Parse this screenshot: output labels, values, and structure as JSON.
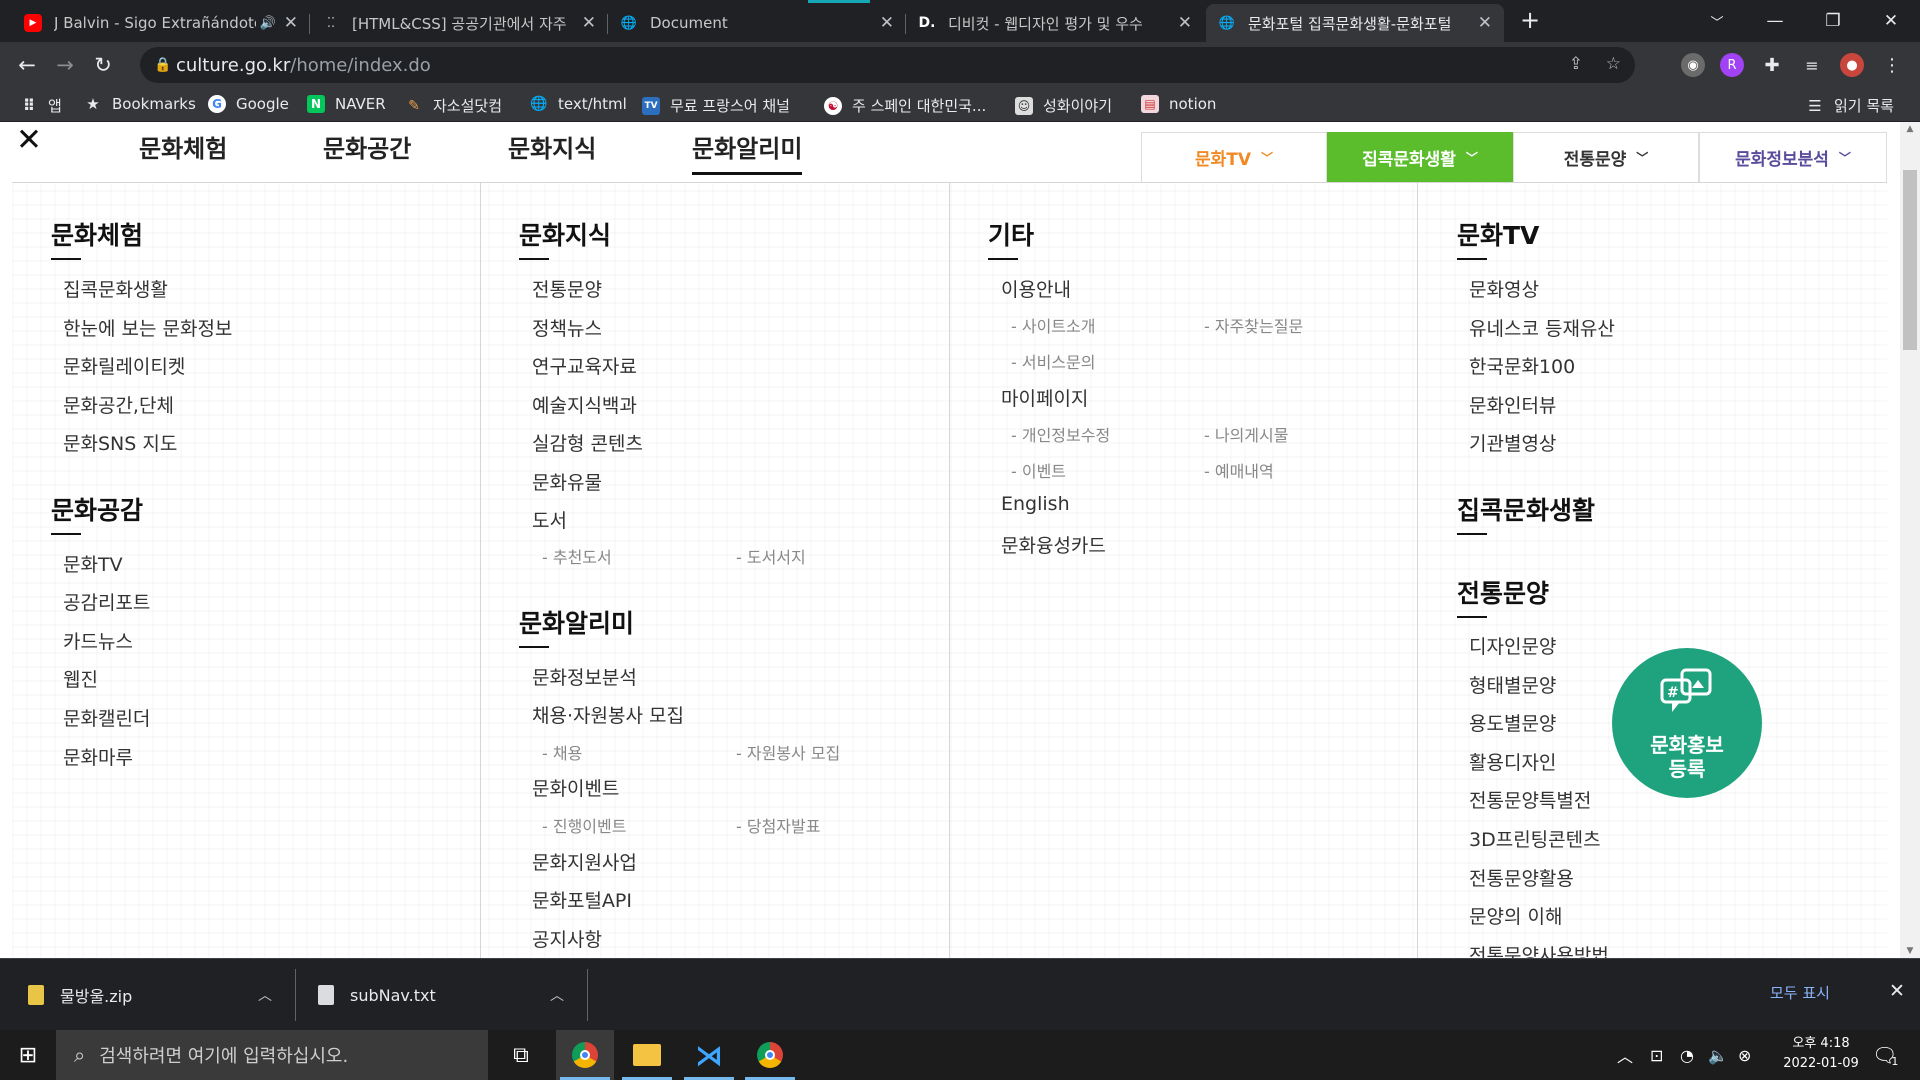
{
  "browser": {
    "tabs": [
      {
        "title": "J Balvin - Sigo Extrañándote",
        "icon": "youtube-icon"
      },
      {
        "title": "[HTML&CSS] 공공기관에서 자주",
        "icon": "tistory-icon"
      },
      {
        "title": "Document",
        "icon": "globe-icon"
      },
      {
        "title": "디비컷 - 웹디자인 평가 및 우수",
        "icon": "dbcut-icon"
      },
      {
        "title": "문화포털 집콕문화생활-문화포털",
        "icon": "globe-icon"
      }
    ],
    "url_host": "culture.go.kr",
    "url_path": "/home/index.do",
    "bookmarks": [
      "앱",
      "Bookmarks",
      "Google",
      "NAVER",
      "자소설닷컴",
      "text/html",
      "무료 프랑스어 채널",
      "주 스페인 대한민국...",
      "성화이야기",
      "notion"
    ],
    "reading_list": "읽기 목록"
  },
  "page": {
    "gnb": [
      "문화체험",
      "문화공간",
      "문화지식",
      "문화알리미"
    ],
    "quick_menu": [
      {
        "label": "문화TV",
        "color": "#f08a24"
      },
      {
        "label": "집콕문화생활",
        "color": "#ffffff",
        "bg": "#5bbd2b"
      },
      {
        "label": "전통문양",
        "color": "#333333"
      },
      {
        "label": "문화정보분석",
        "color": "#5a4b9c"
      }
    ],
    "columns": {
      "col1": {
        "sec1": {
          "title": "문화체험",
          "items": [
            "집콕문화생활",
            "한눈에 보는 문화정보",
            "문화릴레이티켓",
            "문화공간,단체",
            "문화SNS 지도"
          ]
        },
        "sec2": {
          "title": "문화공감",
          "items": [
            "문화TV",
            "공감리포트",
            "카드뉴스",
            "웹진",
            "문화캘린더",
            "문화마루"
          ]
        }
      },
      "col2": {
        "sec1": {
          "title": "문화지식",
          "items": [
            "전통문양",
            "정책뉴스",
            "연구교육자료",
            "예술지식백과",
            "실감형 콘텐츠",
            "문화유물",
            "도서"
          ],
          "subs": [
            "- 추천도서",
            "- 도서서지"
          ]
        },
        "sec2": {
          "title": "문화알리미",
          "items": [
            "문화정보분석",
            "채용·자원봉사 모집",
            "문화이벤트",
            "문화지원사업",
            "문화포털API",
            "공지사항"
          ],
          "subs_a": [
            "- 채용",
            "- 자원봉사 모집"
          ],
          "subs_b": [
            "- 진행이벤트",
            "- 당첨자발표"
          ]
        }
      },
      "col3": {
        "title": "기타",
        "items": [
          "이용안내",
          "마이페이지",
          "English",
          "문화융성카드"
        ],
        "subs_a": [
          "- 사이트소개",
          "- 자주찾는질문",
          "- 서비스문의"
        ],
        "subs_b": [
          "- 개인정보수정",
          "- 나의게시물",
          "- 이벤트",
          "- 예매내역"
        ]
      },
      "col4": {
        "sec1": {
          "title": "문화TV",
          "items": [
            "문화영상",
            "유네스코 등재유산",
            "한국문화100",
            "문화인터뷰",
            "기관별영상"
          ]
        },
        "sec2": {
          "title": "집콕문화생활"
        },
        "sec3": {
          "title": "전통문양",
          "items": [
            "디자인문양",
            "형태별문양",
            "용도별문양",
            "활용디자인",
            "전통문양특별전",
            "3D프린팅콘텐츠",
            "전통문양활용",
            "문양의 이해",
            "전통문양사용방법"
          ]
        }
      }
    },
    "promo": {
      "line1": "문화홍보",
      "line2": "등록",
      "color": "#1fa37e"
    }
  },
  "downloads": {
    "items": [
      "물방울.zip",
      "subNav.txt"
    ],
    "show_all": "모두 표시"
  },
  "taskbar": {
    "search_placeholder": "검색하려면 여기에 입력하십시오.",
    "time": "오후 4:18",
    "date": "2022-01-09",
    "notification_count": "1"
  }
}
